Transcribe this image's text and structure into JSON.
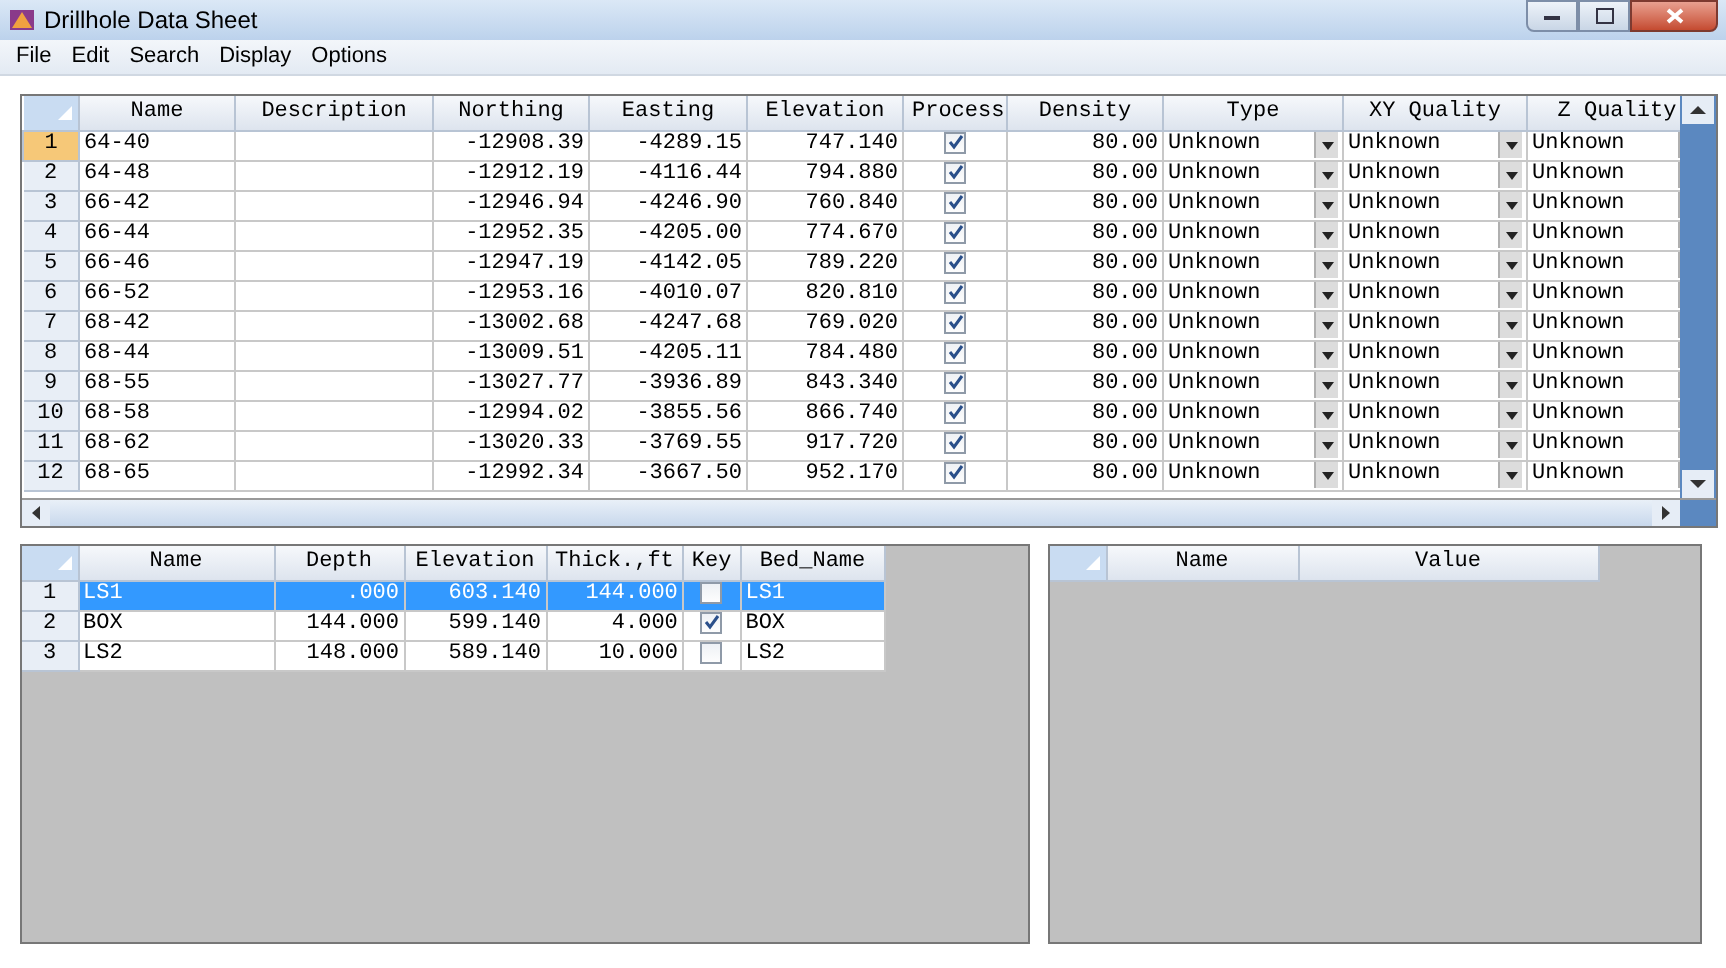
{
  "window": {
    "title": "Drillhole Data Sheet"
  },
  "menu": [
    "File",
    "Edit",
    "Search",
    "Display",
    "Options"
  ],
  "holes": {
    "columns": [
      "Name",
      "Description",
      "Northing",
      "Easting",
      "Elevation",
      "Process",
      "Density",
      "Type",
      "XY Quality",
      "Z Quality"
    ],
    "rows": [
      {
        "num": "1",
        "selected": true,
        "name": "64-40",
        "northing": "-12908.39",
        "easting": "-4289.15",
        "elevation": "747.140",
        "process": true,
        "density": "80.00",
        "type": "Unknown",
        "xy": "Unknown",
        "z": "Unknown"
      },
      {
        "num": "2",
        "selected": false,
        "name": "64-48",
        "northing": "-12912.19",
        "easting": "-4116.44",
        "elevation": "794.880",
        "process": true,
        "density": "80.00",
        "type": "Unknown",
        "xy": "Unknown",
        "z": "Unknown"
      },
      {
        "num": "3",
        "selected": false,
        "name": "66-42",
        "northing": "-12946.94",
        "easting": "-4246.90",
        "elevation": "760.840",
        "process": true,
        "density": "80.00",
        "type": "Unknown",
        "xy": "Unknown",
        "z": "Unknown"
      },
      {
        "num": "4",
        "selected": false,
        "name": "66-44",
        "northing": "-12952.35",
        "easting": "-4205.00",
        "elevation": "774.670",
        "process": true,
        "density": "80.00",
        "type": "Unknown",
        "xy": "Unknown",
        "z": "Unknown"
      },
      {
        "num": "5",
        "selected": false,
        "name": "66-46",
        "northing": "-12947.19",
        "easting": "-4142.05",
        "elevation": "789.220",
        "process": true,
        "density": "80.00",
        "type": "Unknown",
        "xy": "Unknown",
        "z": "Unknown"
      },
      {
        "num": "6",
        "selected": false,
        "name": "66-52",
        "northing": "-12953.16",
        "easting": "-4010.07",
        "elevation": "820.810",
        "process": true,
        "density": "80.00",
        "type": "Unknown",
        "xy": "Unknown",
        "z": "Unknown"
      },
      {
        "num": "7",
        "selected": false,
        "name": "68-42",
        "northing": "-13002.68",
        "easting": "-4247.68",
        "elevation": "769.020",
        "process": true,
        "density": "80.00",
        "type": "Unknown",
        "xy": "Unknown",
        "z": "Unknown"
      },
      {
        "num": "8",
        "selected": false,
        "name": "68-44",
        "northing": "-13009.51",
        "easting": "-4205.11",
        "elevation": "784.480",
        "process": true,
        "density": "80.00",
        "type": "Unknown",
        "xy": "Unknown",
        "z": "Unknown"
      },
      {
        "num": "9",
        "selected": false,
        "name": "68-55",
        "northing": "-13027.77",
        "easting": "-3936.89",
        "elevation": "843.340",
        "process": true,
        "density": "80.00",
        "type": "Unknown",
        "xy": "Unknown",
        "z": "Unknown"
      },
      {
        "num": "10",
        "selected": false,
        "name": "68-58",
        "northing": "-12994.02",
        "easting": "-3855.56",
        "elevation": "866.740",
        "process": true,
        "density": "80.00",
        "type": "Unknown",
        "xy": "Unknown",
        "z": "Unknown"
      },
      {
        "num": "11",
        "selected": false,
        "name": "68-62",
        "northing": "-13020.33",
        "easting": "-3769.55",
        "elevation": "917.720",
        "process": true,
        "density": "80.00",
        "type": "Unknown",
        "xy": "Unknown",
        "z": "Unknown"
      },
      {
        "num": "12",
        "selected": false,
        "name": "68-65",
        "northing": "-12992.34",
        "easting": "-3667.50",
        "elevation": "952.170",
        "process": true,
        "density": "80.00",
        "type": "Unknown",
        "xy": "Unknown",
        "z": "Unknown"
      }
    ]
  },
  "beds": {
    "columns": [
      "Name",
      "Depth",
      "Elevation",
      "Thick.,ft",
      "Key",
      "Bed_Name"
    ],
    "rows": [
      {
        "num": "1",
        "selected": true,
        "name": "LS1",
        "depth": ".000",
        "elevation": "603.140",
        "thick": "144.000",
        "key": false,
        "bed_name": "LS1"
      },
      {
        "num": "2",
        "selected": false,
        "name": "BOX",
        "depth": "144.000",
        "elevation": "599.140",
        "thick": "4.000",
        "key": true,
        "bed_name": "BOX"
      },
      {
        "num": "3",
        "selected": false,
        "name": "LS2",
        "depth": "148.000",
        "elevation": "589.140",
        "thick": "10.000",
        "key": false,
        "bed_name": "LS2"
      }
    ]
  },
  "properties": {
    "columns": [
      "Name",
      "Value"
    ]
  }
}
